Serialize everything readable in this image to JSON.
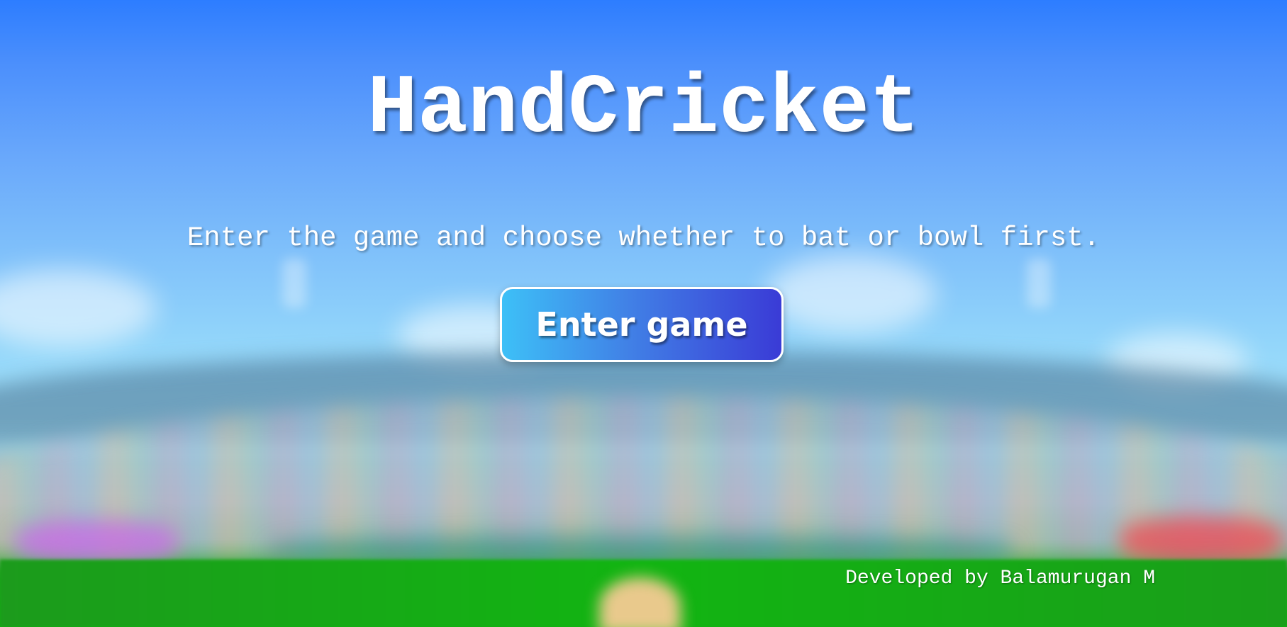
{
  "page": {
    "title": "HandCricket",
    "subtitle": "Enter the game and choose whether to bat or bowl first.",
    "enter_button_label": "Enter game",
    "credit": "Developed by Balamurugan M"
  },
  "colors": {
    "sky_top": "#2d7dff",
    "sky_bottom": "#a6e5fb",
    "grass": "#12b512",
    "button_gradient_start": "#3dc0f7",
    "button_gradient_end": "#3a3bd6",
    "text": "#ffffff"
  }
}
